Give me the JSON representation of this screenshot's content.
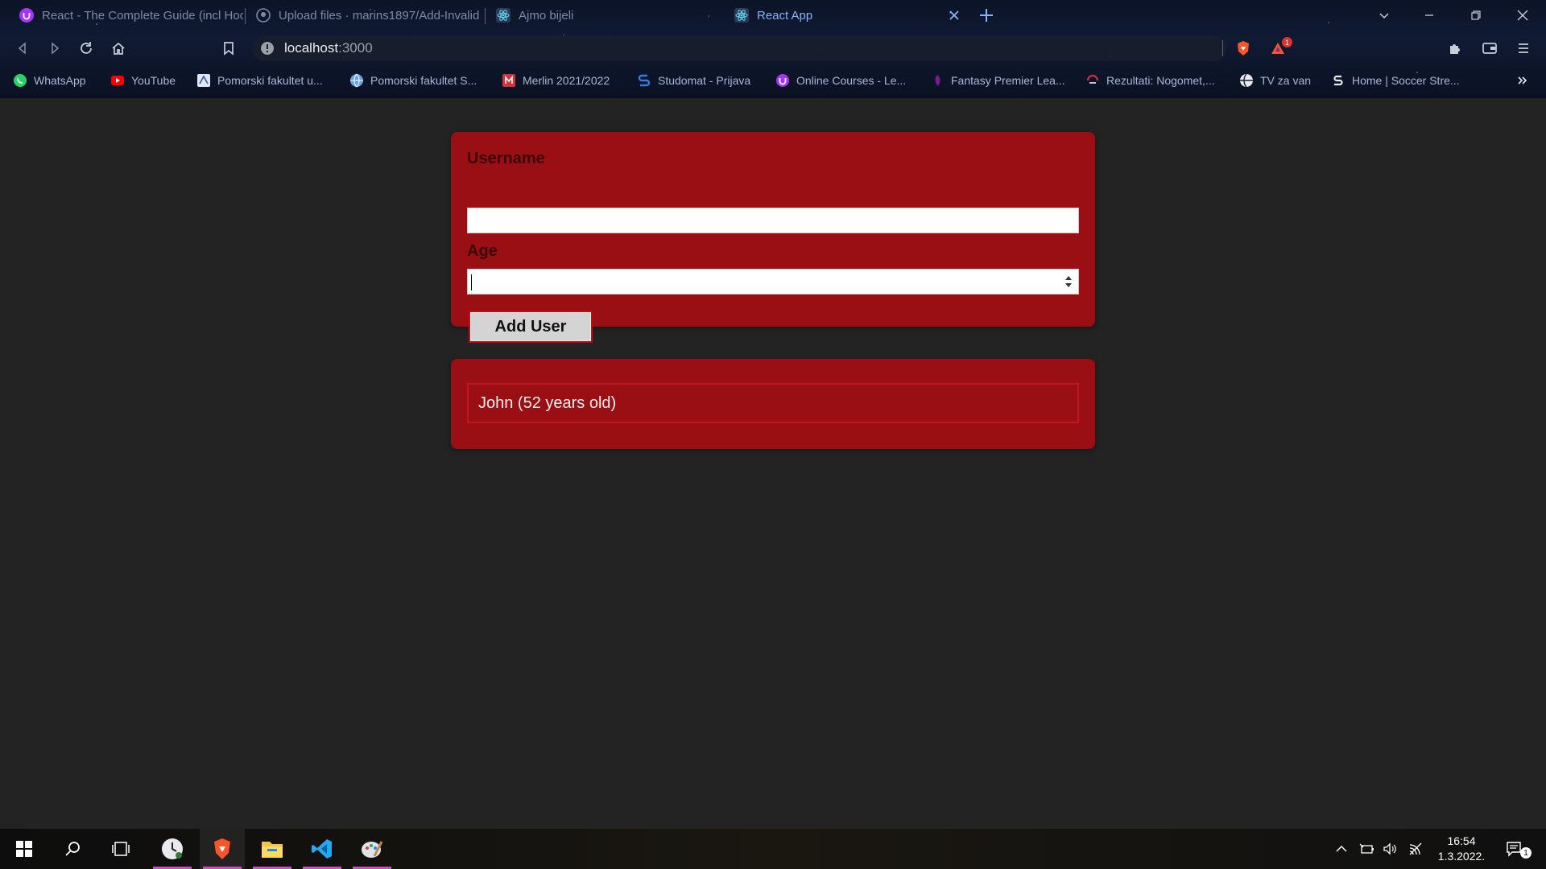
{
  "browser": {
    "tabs": [
      {
        "title": "React - The Complete Guide (incl Hoo",
        "active": false,
        "icon": "udemy-icon"
      },
      {
        "title": "Upload files · marins1897/Add-Invalid",
        "active": false,
        "icon": "github-icon"
      },
      {
        "title": "Ajmo bijeli",
        "active": false,
        "icon": "react-icon"
      },
      {
        "title": "React App",
        "active": true,
        "icon": "react-icon"
      }
    ],
    "url_host": "localhost",
    "url_port": ":3000",
    "brave_badge": "1",
    "bookmarks": [
      {
        "label": "WhatsApp",
        "icon": "whatsapp-icon",
        "color": "#25d366"
      },
      {
        "label": "YouTube",
        "icon": "youtube-icon",
        "color": "#ff0000"
      },
      {
        "label": "Pomorski fakultet u...",
        "icon": "pfst-icon",
        "color": "#5a7ccc"
      },
      {
        "label": "Pomorski fakultet S...",
        "icon": "globe-icon",
        "color": "#6aa0e6"
      },
      {
        "label": "Merlin 2021/2022",
        "icon": "merlin-icon",
        "color": "#d0343a"
      },
      {
        "label": "Studomat - Prijava",
        "icon": "studomat-icon",
        "color": "#2f7de1"
      },
      {
        "label": "Online Courses - Le...",
        "icon": "udemy-icon",
        "color": "#a435f0"
      },
      {
        "label": "Fantasy Premier Lea...",
        "icon": "premier-league-icon",
        "color": "#7a1d8c"
      },
      {
        "label": "Rezultati: Nogomet,...",
        "icon": "flashscore-icon",
        "color": "#d8313a"
      },
      {
        "label": "TV za van",
        "icon": "globe-icon",
        "color": "#e8eaed"
      },
      {
        "label": "Home | Soccer Stre...",
        "icon": "s-icon",
        "color": "#e8eaed"
      }
    ]
  },
  "form": {
    "username_label": "Username",
    "username_value": "",
    "age_label": "Age",
    "age_value": "",
    "submit_label": "Add User"
  },
  "users": [
    {
      "text": "John (52 years old)"
    }
  ],
  "taskbar": {
    "time": "16:54",
    "date": "1.3.2022.",
    "notifications": "1"
  },
  "colors": {
    "card": "#9a0f13",
    "page_bg": "#232323"
  }
}
